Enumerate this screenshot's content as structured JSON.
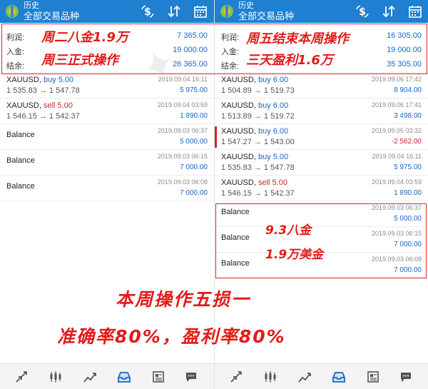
{
  "header": {
    "small": "历史",
    "main": "全部交易品种"
  },
  "labels": {
    "profit": "利润:",
    "deposit": "入金:",
    "balance": "结余:"
  },
  "left": {
    "summary": {
      "profit": "7 365.00",
      "deposit": "19 000.00",
      "balance": "26 365.00"
    },
    "rows": [
      {
        "kind": "trade",
        "symbol": "XAUUSD,",
        "side": "buy 5.00",
        "prices": "1 535.83 → 1 547.78",
        "date": "2019.09.04 16:11",
        "amount": "5 975.00"
      },
      {
        "kind": "trade",
        "symbol": "XAUUSD,",
        "side": "sell 5.00",
        "prices": "1 546.15 → 1 542.37",
        "date": "2019.09.04 03:59",
        "amount": "1 890.00"
      },
      {
        "kind": "balance",
        "label": "Balance",
        "date": "2019.09.03 06:37",
        "amount": "5 000.00"
      },
      {
        "kind": "balance",
        "label": "Balance",
        "date": "2019.09.03 06:15",
        "amount": "7 000.00"
      },
      {
        "kind": "balance",
        "label": "Balance",
        "date": "2019.09.03 06:08",
        "amount": "7 000.00"
      }
    ]
  },
  "right": {
    "summary": {
      "profit": "16 305.00",
      "deposit": "19 000.00",
      "balance": "35 305.00"
    },
    "rows": [
      {
        "kind": "trade",
        "symbol": "XAUUSD,",
        "side": "buy 6.00",
        "prices": "1 504.89 → 1 519.73",
        "date": "2019.09.06 17:42",
        "amount": "8 904.00"
      },
      {
        "kind": "trade",
        "symbol": "XAUUSD,",
        "side": "buy 6.00",
        "prices": "1 513.89 → 1 519.72",
        "date": "2019.09.06 17:41",
        "amount": "3 498.00"
      },
      {
        "kind": "trade",
        "symbol": "XAUUSD,",
        "side": "buy 6.00",
        "prices": "1 547.27 → 1 543.00",
        "date": "2019.09.05 03:32",
        "amount": "-2 562.00"
      },
      {
        "kind": "trade",
        "symbol": "XAUUSD,",
        "side": "buy 5.00",
        "prices": "1 535.83 → 1 547.78",
        "date": "2019.09.04 16:11",
        "amount": "5 975.00"
      },
      {
        "kind": "trade",
        "symbol": "XAUUSD,",
        "side": "sell 5.00",
        "prices": "1 546.15 → 1 542.37",
        "date": "2019.09.04 03:59",
        "amount": "1 890.00"
      },
      {
        "kind": "balance",
        "label": "Balance",
        "date": "2019.09.03 06:37",
        "amount": "5 000.00"
      },
      {
        "kind": "balance",
        "label": "Balance",
        "date": "2019.09.03 06:15",
        "amount": "7 000.00"
      },
      {
        "kind": "balance",
        "label": "Balance",
        "date": "2019.09.03 06:08",
        "amount": "7 000.00"
      }
    ]
  },
  "annotations": {
    "note1": "周二八金1.9万",
    "note2": "周三正式操作",
    "note3": "周五结束本周操作",
    "note4": "三天盈利1.6万",
    "note5": "9.3八金",
    "note6": "1.9万美金",
    "note7": "本周操作五损一",
    "note8": "准确率80%，盈利率80%"
  },
  "colors": {
    "topbar": "#1f7fd0",
    "positive": "#1a66c2",
    "negative": "#c62828",
    "annotation": "#e31b1b"
  },
  "icons": [
    "app-logo-icon",
    "dollar-cycle-icon",
    "sort-icon",
    "calendar-icon",
    "trade-icon",
    "chart-icon",
    "trend-icon",
    "history-icon",
    "news-icon",
    "chat-icon"
  ]
}
